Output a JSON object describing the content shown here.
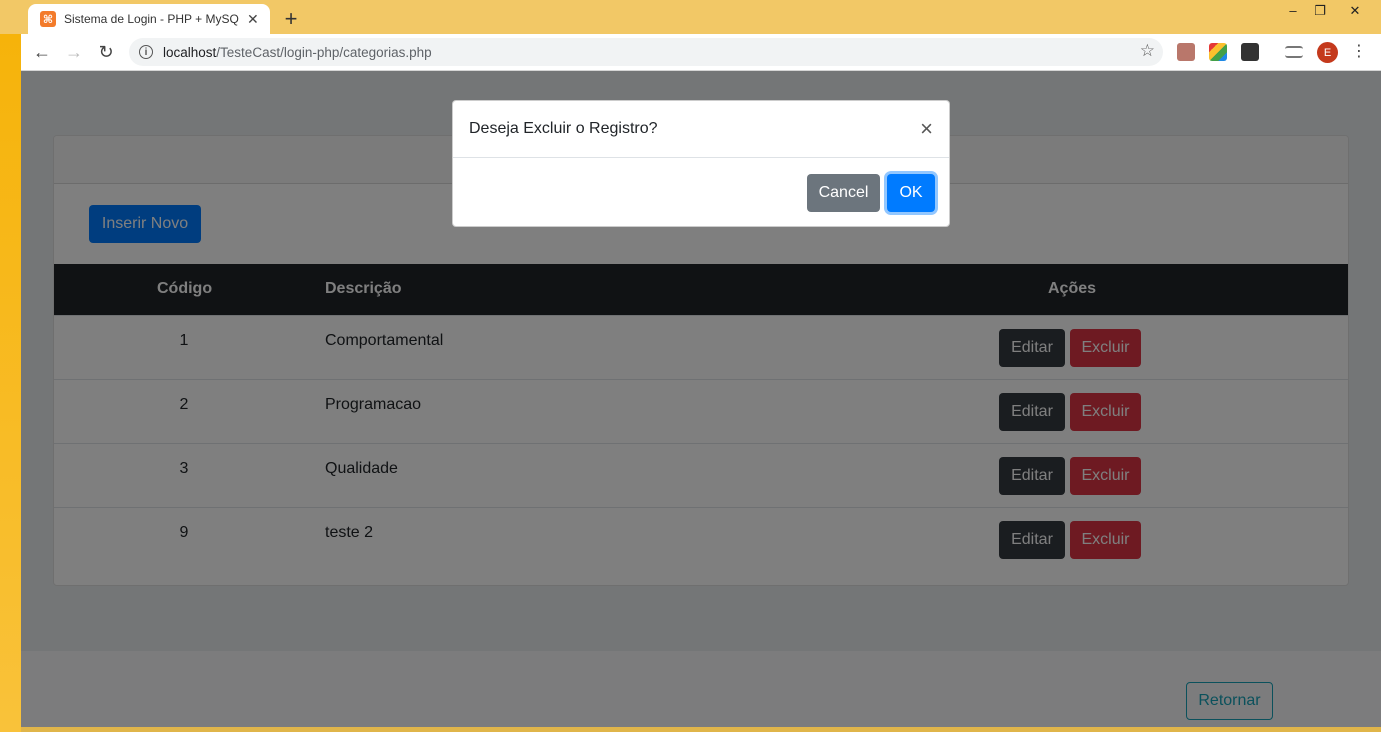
{
  "browser": {
    "tab_title": "Sistema de Login - PHP + MySQL",
    "tab_close": "✕",
    "new_tab": "+",
    "url_host": "localhost",
    "url_path": "/TesteCast/login-php/categorias.php",
    "profile_initial": "E",
    "window_minimize": "‒",
    "window_maximize": "❐",
    "window_close": "✕"
  },
  "page": {
    "insert_button": "Inserir Novo",
    "table": {
      "headers": {
        "code": "Código",
        "description": "Descrição",
        "actions": "Ações"
      },
      "rows": [
        {
          "code": "1",
          "description": "Comportamental",
          "edit": "Editar",
          "delete": "Excluir"
        },
        {
          "code": "2",
          "description": "Programacao",
          "edit": "Editar",
          "delete": "Excluir"
        },
        {
          "code": "3",
          "description": "Qualidade",
          "edit": "Editar",
          "delete": "Excluir"
        },
        {
          "code": "9",
          "description": "teste 2",
          "edit": "Editar",
          "delete": "Excluir"
        }
      ]
    },
    "return_button": "Retornar"
  },
  "modal": {
    "title": "Deseja Excluir o Registro?",
    "close": "×",
    "cancel_label": "Cancel",
    "ok_label": "OK"
  },
  "colors": {
    "primary": "#007bff",
    "secondary": "#6c757d",
    "danger": "#dc3545",
    "dark": "#343a40",
    "info": "#17a2b8"
  }
}
